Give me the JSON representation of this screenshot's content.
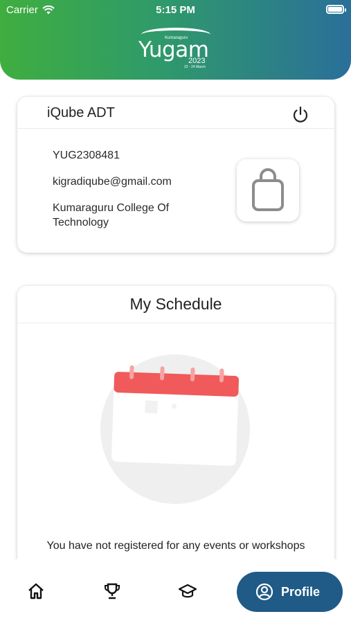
{
  "status_bar": {
    "carrier": "Carrier",
    "time": "5:15 PM",
    "battery_level": 1.0
  },
  "header": {
    "logo": {
      "small": "Kumaraguru",
      "word": "Yugam",
      "year": "2023",
      "dates": "22 - 24 March"
    }
  },
  "profile": {
    "name": "iQube ADT",
    "id": "YUG2308481",
    "email": "kigradiqube@gmail.com",
    "college": "Kumaraguru College Of Technology",
    "icons": {
      "logout": "power-icon",
      "pass": "shopping-bag-icon"
    }
  },
  "schedule": {
    "title": "My Schedule",
    "empty_message": "You have not registered for any events or workshops",
    "illustration": "calendar-illustration"
  },
  "bottom_nav": {
    "items": [
      {
        "icon": "home-icon"
      },
      {
        "icon": "trophy-icon"
      },
      {
        "icon": "graduation-cap-icon"
      }
    ],
    "active": {
      "icon": "user-circle-icon",
      "label": "Profile"
    }
  },
  "colors": {
    "header_start": "#3fae3f",
    "header_end": "#2a6f9a",
    "nav_active": "#205a86",
    "calendar_red": "#f05a5a"
  }
}
